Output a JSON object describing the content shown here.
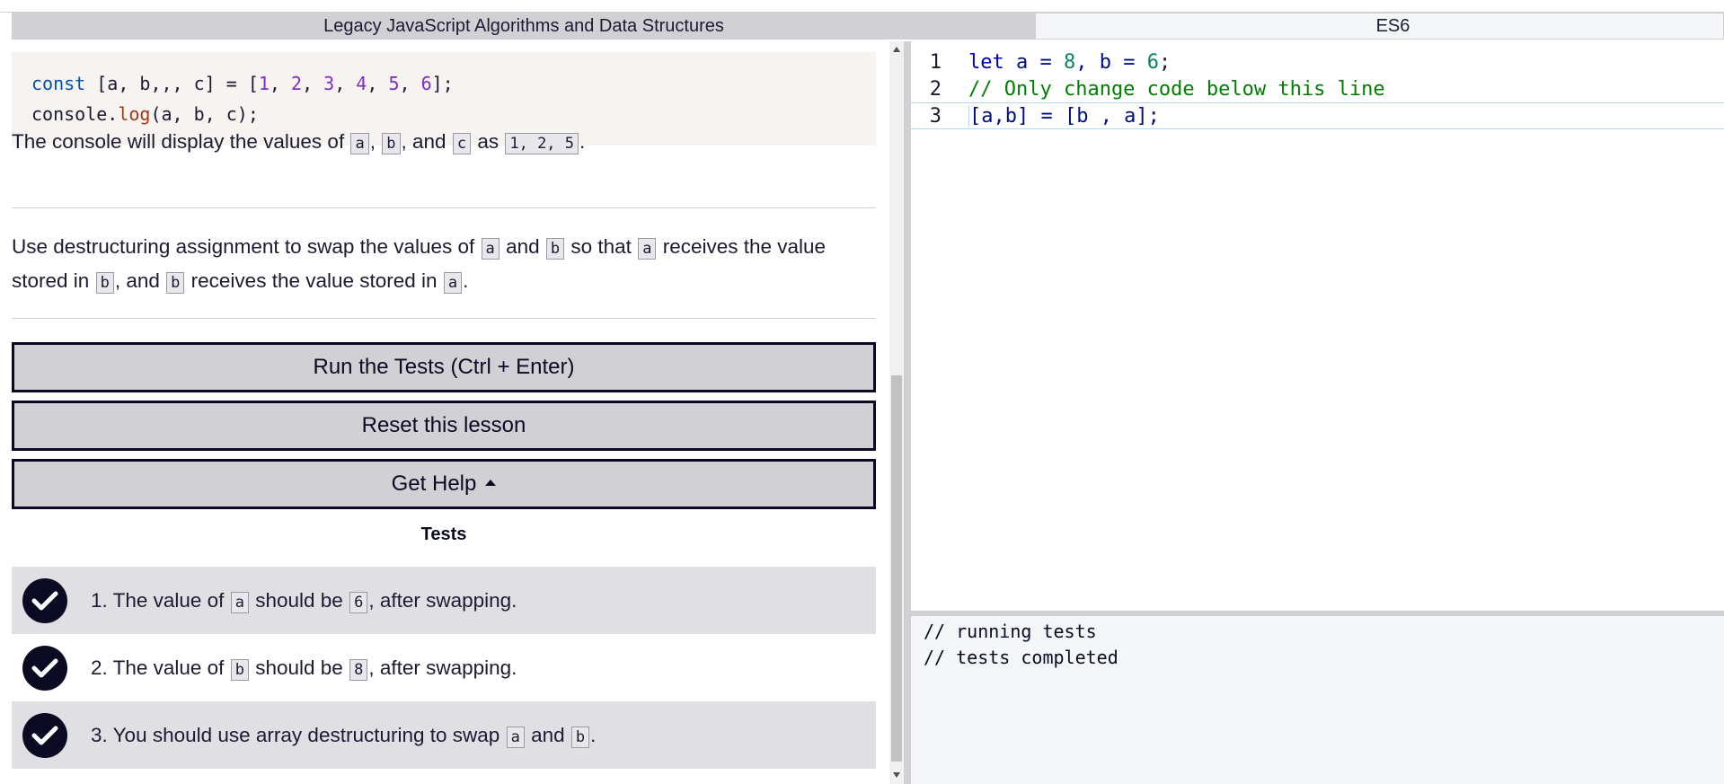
{
  "breadcrumb": {
    "superblock": "Legacy JavaScript Algorithms and Data Structures",
    "block": "ES6"
  },
  "instructions": {
    "example_code": {
      "line1": {
        "kw": "const",
        "lhs": " [a, b,,, c] = [",
        "n1": "1",
        "n2": "2",
        "n3": "3",
        "n4": "4",
        "n5": "5",
        "n6": "6",
        "end": "];"
      },
      "line2": {
        "obj": "console.",
        "fn": "log",
        "args": "(a, b, c);"
      }
    },
    "p1": {
      "t1": "The console will display the values of",
      "c1": "a",
      "t2": ",",
      "c2": "b",
      "t3": ", and",
      "c3": "c",
      "t4": "as",
      "c4": "1, 2, 5",
      "t5": "."
    },
    "p2": {
      "t1": "Use destructuring assignment to swap the values of",
      "c1": "a",
      "t2": "and",
      "c2": "b",
      "t3": "so that",
      "c3": "a",
      "t4": "receives the value",
      "t5": "stored in",
      "c4": "b",
      "t6": ", and",
      "c5": "b",
      "t7": "receives the value stored in",
      "c6": "a",
      "t8": "."
    }
  },
  "buttons": {
    "run": "Run the Tests (Ctrl + Enter)",
    "reset": "Reset this lesson",
    "help": "Get Help"
  },
  "tests": {
    "title": "Tests",
    "items": [
      {
        "t1": "1. The value of",
        "c1": "a",
        "t2": "should be",
        "c2": "6",
        "t3": ", after swapping."
      },
      {
        "t1": "2. The value of",
        "c1": "b",
        "t2": "should be",
        "c2": "8",
        "t3": ", after swapping."
      },
      {
        "t1": "3. You should use array destructuring to swap",
        "c1": "a",
        "t2": "and",
        "c2": "b",
        "t3": "."
      }
    ]
  },
  "editor": {
    "lines": [
      {
        "num": "1",
        "kw": "let",
        "a": " a = ",
        "n1": "8",
        "b": ", b = ",
        "n2": "6",
        "end": ";"
      },
      {
        "num": "2",
        "comment": "// Only change code below this line"
      },
      {
        "num": "3",
        "code": "[a,b] = [b , a];"
      }
    ]
  },
  "console": {
    "lines": [
      "// running tests",
      "// tests completed"
    ]
  },
  "colors": {
    "dark": "#0a0a23",
    "gray": "#d0d0d5",
    "row_shade": "#e0e0e4"
  }
}
